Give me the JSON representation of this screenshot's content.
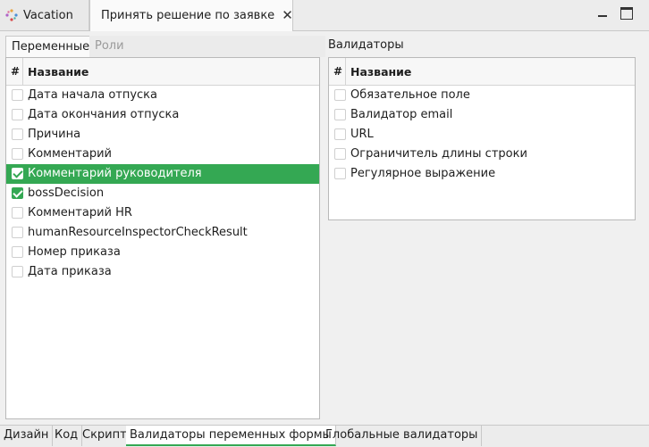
{
  "editor_tabs": [
    {
      "label": "Vacation",
      "icon": "process-icon"
    },
    {
      "label": "Принять решение по заявке",
      "icon": "form-window-icon"
    }
  ],
  "window_controls": {
    "minimize": "minimize-icon",
    "maximize": "maximize-icon"
  },
  "left": {
    "tabs": [
      "Переменные",
      "Роли"
    ],
    "columns": {
      "hash": "#",
      "name": "Название"
    },
    "rows": [
      {
        "label": "Дата начала отпуска",
        "checked": false,
        "selected": false
      },
      {
        "label": "Дата окончания отпуска",
        "checked": false,
        "selected": false
      },
      {
        "label": "Причина",
        "checked": false,
        "selected": false
      },
      {
        "label": "Комментарий",
        "checked": false,
        "selected": false
      },
      {
        "label": "Комментарий руководителя",
        "checked": true,
        "selected": true
      },
      {
        "label": "bossDecision",
        "checked": true,
        "selected": false
      },
      {
        "label": "Комментарий HR",
        "checked": false,
        "selected": false
      },
      {
        "label": "humanResourceInspectorCheckResult",
        "checked": false,
        "selected": false
      },
      {
        "label": "Номер приказа",
        "checked": false,
        "selected": false
      },
      {
        "label": "Дата приказа",
        "checked": false,
        "selected": false
      }
    ]
  },
  "right": {
    "title": "Валидаторы",
    "columns": {
      "hash": "#",
      "name": "Название"
    },
    "rows": [
      {
        "label": "Обязательное поле",
        "checked": false
      },
      {
        "label": "Валидатор email",
        "checked": false
      },
      {
        "label": "URL",
        "checked": false
      },
      {
        "label": "Ограничитель длины строки",
        "checked": false
      },
      {
        "label": "Регулярное выражение",
        "checked": false
      }
    ]
  },
  "bottom_tabs": [
    {
      "label": "Дизайн",
      "active": false
    },
    {
      "label": "Код",
      "active": false
    },
    {
      "label": "Скрипт",
      "active": false
    },
    {
      "label": "Валидаторы переменных формы",
      "active": true
    },
    {
      "label": "Глобальные валидаторы",
      "active": false
    }
  ],
  "colors": {
    "accent": "#34a853",
    "background": "#f0f0f0",
    "panel": "#ffffff"
  }
}
